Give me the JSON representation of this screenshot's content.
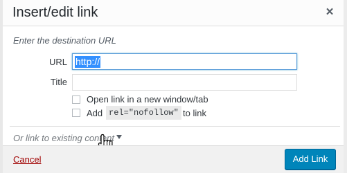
{
  "dialog": {
    "title": "Insert/edit link",
    "close_icon": "close-icon",
    "close_symbol": "×"
  },
  "form": {
    "hint": "Enter the destination URL",
    "url_label": "URL",
    "url_value": "http://",
    "title_label": "Title",
    "title_value": "",
    "open_new_tab_label": "Open link in a new window/tab",
    "open_new_tab_checked": false,
    "nofollow_prefix": "Add",
    "nofollow_code": "rel=\"nofollow\"",
    "nofollow_suffix": "to link",
    "nofollow_checked": false
  },
  "existing": {
    "toggle_label": "Or link to existing content",
    "toggle_icon": "triangle-down-icon"
  },
  "footer": {
    "cancel_label": "Cancel",
    "submit_label": "Add Link"
  },
  "colors": {
    "primary_button": "#0085ba",
    "cancel_link": "#a00000",
    "selection": "#3390ff",
    "focus_border": "#5b9dd9"
  }
}
